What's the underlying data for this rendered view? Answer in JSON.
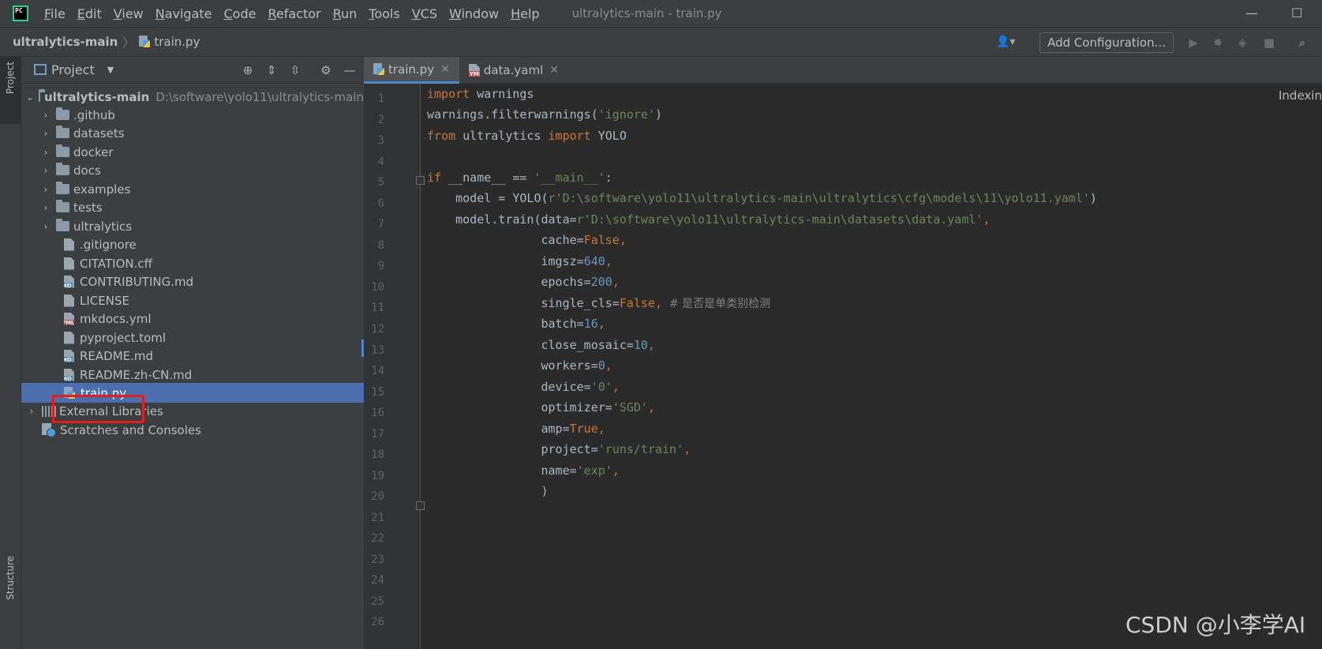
{
  "menu": [
    "File",
    "Edit",
    "View",
    "Navigate",
    "Code",
    "Refactor",
    "Run",
    "Tools",
    "VCS",
    "Window",
    "Help"
  ],
  "window_title": "ultralytics-main - train.py",
  "breadcrumb": {
    "project": "ultralytics-main",
    "file": "train.py"
  },
  "toolbar": {
    "add_config_label": "Add Configuration..."
  },
  "left_strip": {
    "project_label": "Project",
    "structure_label": "Structure"
  },
  "project_panel": {
    "title": "Project",
    "root": {
      "name": "ultralytics-main",
      "path": "D:\\software\\yolo11\\ultralytics-main"
    },
    "items": [
      {
        "label": ".github",
        "kind": "folder"
      },
      {
        "label": "datasets",
        "kind": "folder"
      },
      {
        "label": "docker",
        "kind": "folder"
      },
      {
        "label": "docs",
        "kind": "folder"
      },
      {
        "label": "examples",
        "kind": "folder"
      },
      {
        "label": "tests",
        "kind": "folder"
      },
      {
        "label": "ultralytics",
        "kind": "folder"
      },
      {
        "label": ".gitignore",
        "kind": "file"
      },
      {
        "label": "CITATION.cff",
        "kind": "file"
      },
      {
        "label": "CONTRIBUTING.md",
        "kind": "md"
      },
      {
        "label": "LICENSE",
        "kind": "file"
      },
      {
        "label": "mkdocs.yml",
        "kind": "yml"
      },
      {
        "label": "pyproject.toml",
        "kind": "file"
      },
      {
        "label": "README.md",
        "kind": "md"
      },
      {
        "label": "README.zh-CN.md",
        "kind": "md"
      },
      {
        "label": "train.py",
        "kind": "py",
        "selected": true
      }
    ],
    "external_libraries": "External Libraries",
    "scratches": "Scratches and Consoles"
  },
  "tabs": [
    {
      "label": "train.py",
      "active": true
    },
    {
      "label": "data.yaml",
      "active": false
    }
  ],
  "editor": {
    "status": "Indexing",
    "line_numbers": [
      "1",
      "2",
      "3",
      "4",
      "5",
      "6",
      "7",
      "8",
      "9",
      "10",
      "11",
      "12",
      "13",
      "14",
      "15",
      "16",
      "17",
      "18",
      "19",
      "20",
      "21",
      "22",
      "23",
      "24",
      "25",
      "26"
    ],
    "code": {
      "l1_kw": "import",
      "l1_rest": " warnings",
      "l2_a": "warnings.filterwarnings(",
      "l2_str": "'ignore'",
      "l2_b": ")",
      "l3_kw1": "from",
      "l3_mod": " ultralytics ",
      "l3_kw2": "import",
      "l3_rest": " YOLO",
      "l5_kw": "if",
      "l5_a": " __name__ == ",
      "l5_str": "'__main__'",
      "l5_b": ":",
      "l6_a": "    model = YOLO(",
      "l6_str": "r'D:\\software\\yolo11\\ultralytics-main\\ultralytics\\cfg\\models\\11\\yolo11.yaml'",
      "l6_b": ")",
      "l7_a": "    model.train(data=",
      "l7_str": "r'D:\\software\\yolo11\\ultralytics-main\\datasets\\data.yaml'",
      "l7_b": ",",
      "l8_a": "                cache=",
      "l8_v": "False",
      "l8_b": ",",
      "l9_a": "                imgsz=",
      "l9_v": "640",
      "l9_b": ",",
      "l10_a": "                epochs=",
      "l10_v": "200",
      "l10_b": ",",
      "l11_a": "                single_cls=",
      "l11_v": "False",
      "l11_b": ",",
      "l11_cmt": "  # 是否是单类别检测",
      "l12_a": "                batch=",
      "l12_v": "16",
      "l12_b": ",",
      "l13_a": "                close_mosaic=",
      "l13_v": "10",
      "l13_b": ",",
      "l14_a": "                workers=",
      "l14_v": "0",
      "l14_b": ",",
      "l15_a": "                device=",
      "l15_v": "'0'",
      "l15_b": ",",
      "l16_a": "                optimizer=",
      "l16_v": "'SGD'",
      "l16_b": ",",
      "l17_a": "                amp=",
      "l17_v": "True",
      "l17_b": ",",
      "l18_a": "                project=",
      "l18_v": "'runs/train'",
      "l18_b": ",",
      "l19_a": "                name=",
      "l19_v": "'exp'",
      "l19_b": ",",
      "l20_a": "                )"
    }
  },
  "watermark": "CSDN @小李学AI",
  "colors": {
    "accent": "#4a88c7",
    "selection": "#4b6eaf",
    "highlight_box": "#e02020",
    "keyword": "#cc7832",
    "string": "#6a8759",
    "number": "#6897bb"
  }
}
